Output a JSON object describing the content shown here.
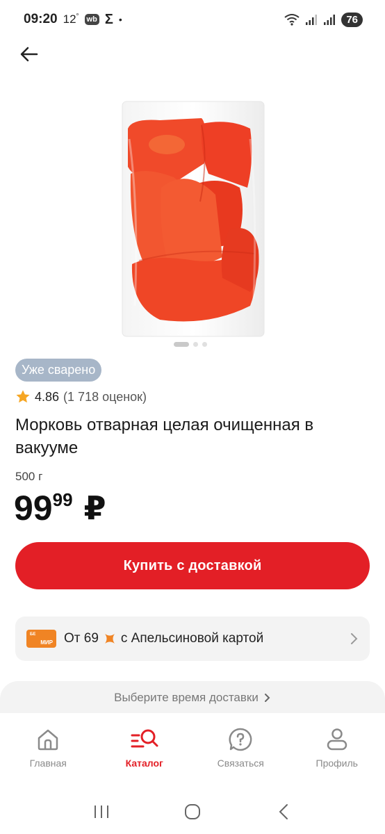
{
  "status_bar": {
    "time": "09:20",
    "temperature": "12",
    "degree": "°",
    "wb_badge": "wb",
    "sigma": "Σ",
    "dot": "•",
    "battery": "76"
  },
  "product": {
    "image_icon": "vacuum-pack-carrots-image",
    "carousel": {
      "total": 3,
      "active_index": 0
    },
    "tag": "Уже сварено",
    "rating": {
      "value": "4.86",
      "count_text": "(1 718 оценок)",
      "star_color": "#f6a623"
    },
    "title": "Морковь отварная целая очищенная в вакууме",
    "weight": "500 г",
    "price": {
      "main": "99",
      "kopecks": "99",
      "currency": "₽"
    }
  },
  "buy_button": {
    "label": "Купить с доставкой",
    "color": "#e31f26"
  },
  "promo": {
    "card_top": "БЕ",
    "card_brand": "МИР",
    "prefix": "От 69",
    "suffix": "с Апельсиновой картой",
    "card_color": "#f08424"
  },
  "delivery": {
    "label": "Выберите время доставки"
  },
  "bottom_nav": {
    "items": [
      {
        "label": "Главная",
        "icon": "home-icon",
        "active": false
      },
      {
        "label": "Каталог",
        "icon": "catalog-search-icon",
        "active": true
      },
      {
        "label": "Связаться",
        "icon": "help-chat-icon",
        "active": false
      },
      {
        "label": "Профиль",
        "icon": "profile-icon",
        "active": false
      }
    ]
  },
  "colors": {
    "accent": "#e31f26",
    "tag_bg": "#a7b6c8",
    "promo_bg": "#f3f3f3"
  }
}
